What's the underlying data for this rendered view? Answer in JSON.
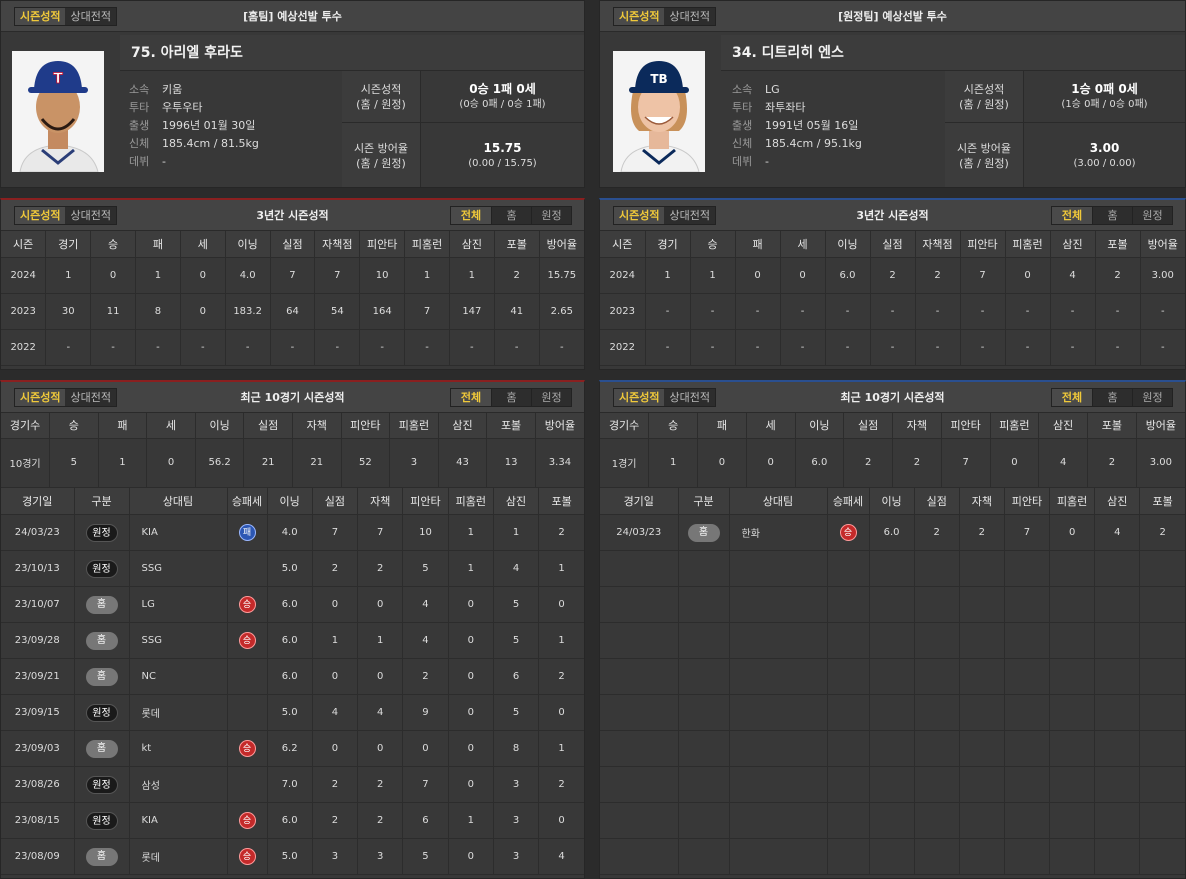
{
  "toggle": {
    "season": "시즌성적",
    "versus": "상대전적"
  },
  "seg": {
    "all": "전체",
    "home": "홈",
    "away": "원정"
  },
  "labels": {
    "team": "소속",
    "throwbat": "투타",
    "birth": "출생",
    "body": "신체",
    "debut": "데뷔",
    "season_record": "시즌성적",
    "season_era": "시즌 방어율",
    "home_away": "(홈 / 원정)"
  },
  "year_headers": [
    "시즌",
    "경기",
    "승",
    "패",
    "세",
    "이닝",
    "실점",
    "자책점",
    "피안타",
    "피홈런",
    "삼진",
    "포볼",
    "방어율"
  ],
  "recent_headers": [
    "경기수",
    "승",
    "패",
    "세",
    "이닝",
    "실점",
    "자책",
    "피안타",
    "피홈런",
    "삼진",
    "포볼",
    "방어율"
  ],
  "game_headers": [
    "경기일",
    "구분",
    "상대팀",
    "승패세",
    "이닝",
    "실점",
    "자책",
    "피안타",
    "피홈런",
    "삼진",
    "포볼"
  ],
  "home": {
    "header": "[홈팀] 예상선발 투수",
    "name": "75. 아리엘 후라도",
    "team": "키움",
    "throwbat": "우투우타",
    "birth": "1996년 01월 30일",
    "body": "185.4cm / 81.5kg",
    "debut": "-",
    "record_main": "0승 1패 0세",
    "record_sub": "(0승 0패 / 0승 1패)",
    "era_main": "15.75",
    "era_sub": "(0.00 / 15.75)",
    "year_title": "3년간 시즌성적",
    "years": [
      [
        "2024",
        "1",
        "0",
        "1",
        "0",
        "4.0",
        "7",
        "7",
        "10",
        "1",
        "1",
        "2",
        "15.75"
      ],
      [
        "2023",
        "30",
        "11",
        "8",
        "0",
        "183.2",
        "64",
        "54",
        "164",
        "7",
        "147",
        "41",
        "2.65"
      ],
      [
        "2022",
        "-",
        "-",
        "-",
        "-",
        "-",
        "-",
        "-",
        "-",
        "-",
        "-",
        "-",
        "-"
      ]
    ],
    "recent_title": "최근 10경기 시즌성적",
    "recent": [
      "10경기",
      "5",
      "1",
      "0",
      "56.2",
      "21",
      "21",
      "52",
      "3",
      "43",
      "13",
      "3.34"
    ],
    "games": [
      {
        "date": "24/03/23",
        "type": "원정",
        "opp": "KIA",
        "res": "패",
        "ip": "4.0",
        "r": "7",
        "er": "7",
        "h": "10",
        "hr": "1",
        "so": "1",
        "bb": "2"
      },
      {
        "date": "23/10/13",
        "type": "원정",
        "opp": "SSG",
        "res": "",
        "ip": "5.0",
        "r": "2",
        "er": "2",
        "h": "5",
        "hr": "1",
        "so": "4",
        "bb": "1"
      },
      {
        "date": "23/10/07",
        "type": "홈",
        "opp": "LG",
        "res": "승",
        "ip": "6.0",
        "r": "0",
        "er": "0",
        "h": "4",
        "hr": "0",
        "so": "5",
        "bb": "0"
      },
      {
        "date": "23/09/28",
        "type": "홈",
        "opp": "SSG",
        "res": "승",
        "ip": "6.0",
        "r": "1",
        "er": "1",
        "h": "4",
        "hr": "0",
        "so": "5",
        "bb": "1"
      },
      {
        "date": "23/09/21",
        "type": "홈",
        "opp": "NC",
        "res": "",
        "ip": "6.0",
        "r": "0",
        "er": "0",
        "h": "2",
        "hr": "0",
        "so": "6",
        "bb": "2"
      },
      {
        "date": "23/09/15",
        "type": "원정",
        "opp": "롯데",
        "res": "",
        "ip": "5.0",
        "r": "4",
        "er": "4",
        "h": "9",
        "hr": "0",
        "so": "5",
        "bb": "0"
      },
      {
        "date": "23/09/03",
        "type": "홈",
        "opp": "kt",
        "res": "승",
        "ip": "6.2",
        "r": "0",
        "er": "0",
        "h": "0",
        "hr": "0",
        "so": "8",
        "bb": "1"
      },
      {
        "date": "23/08/26",
        "type": "원정",
        "opp": "삼성",
        "res": "",
        "ip": "7.0",
        "r": "2",
        "er": "2",
        "h": "7",
        "hr": "0",
        "so": "3",
        "bb": "2"
      },
      {
        "date": "23/08/15",
        "type": "원정",
        "opp": "KIA",
        "res": "승",
        "ip": "6.0",
        "r": "2",
        "er": "2",
        "h": "6",
        "hr": "1",
        "so": "3",
        "bb": "0"
      },
      {
        "date": "23/08/09",
        "type": "홈",
        "opp": "롯데",
        "res": "승",
        "ip": "5.0",
        "r": "3",
        "er": "3",
        "h": "5",
        "hr": "0",
        "so": "3",
        "bb": "4"
      }
    ]
  },
  "away": {
    "header": "[원정팀] 예상선발 투수",
    "name": "34. 디트리히 엔스",
    "team": "LG",
    "throwbat": "좌투좌타",
    "birth": "1991년 05월 16일",
    "body": "185.4cm / 95.1kg",
    "debut": "-",
    "record_main": "1승 0패 0세",
    "record_sub": "(1승 0패 / 0승 0패)",
    "era_main": "3.00",
    "era_sub": "(3.00 / 0.00)",
    "year_title": "3년간 시즌성적",
    "years": [
      [
        "2024",
        "1",
        "1",
        "0",
        "0",
        "6.0",
        "2",
        "2",
        "7",
        "0",
        "4",
        "2",
        "3.00"
      ],
      [
        "2023",
        "-",
        "-",
        "-",
        "-",
        "-",
        "-",
        "-",
        "-",
        "-",
        "-",
        "-",
        "-"
      ],
      [
        "2022",
        "-",
        "-",
        "-",
        "-",
        "-",
        "-",
        "-",
        "-",
        "-",
        "-",
        "-",
        "-"
      ]
    ],
    "recent_title": "최근 10경기 시즌성적",
    "recent": [
      "1경기",
      "1",
      "0",
      "0",
      "6.0",
      "2",
      "2",
      "7",
      "0",
      "4",
      "2",
      "3.00"
    ],
    "games": [
      {
        "date": "24/03/23",
        "type": "홈",
        "opp": "한화",
        "res": "승",
        "ip": "6.0",
        "r": "2",
        "er": "2",
        "h": "7",
        "hr": "0",
        "so": "4",
        "bb": "2"
      }
    ],
    "empty_rows": 9
  },
  "colors": {
    "accent": "#f0c93a",
    "home_line": "#8a2020",
    "away_line": "#2a4f90",
    "win": "#c42a2a",
    "loss": "#2c57b4"
  }
}
